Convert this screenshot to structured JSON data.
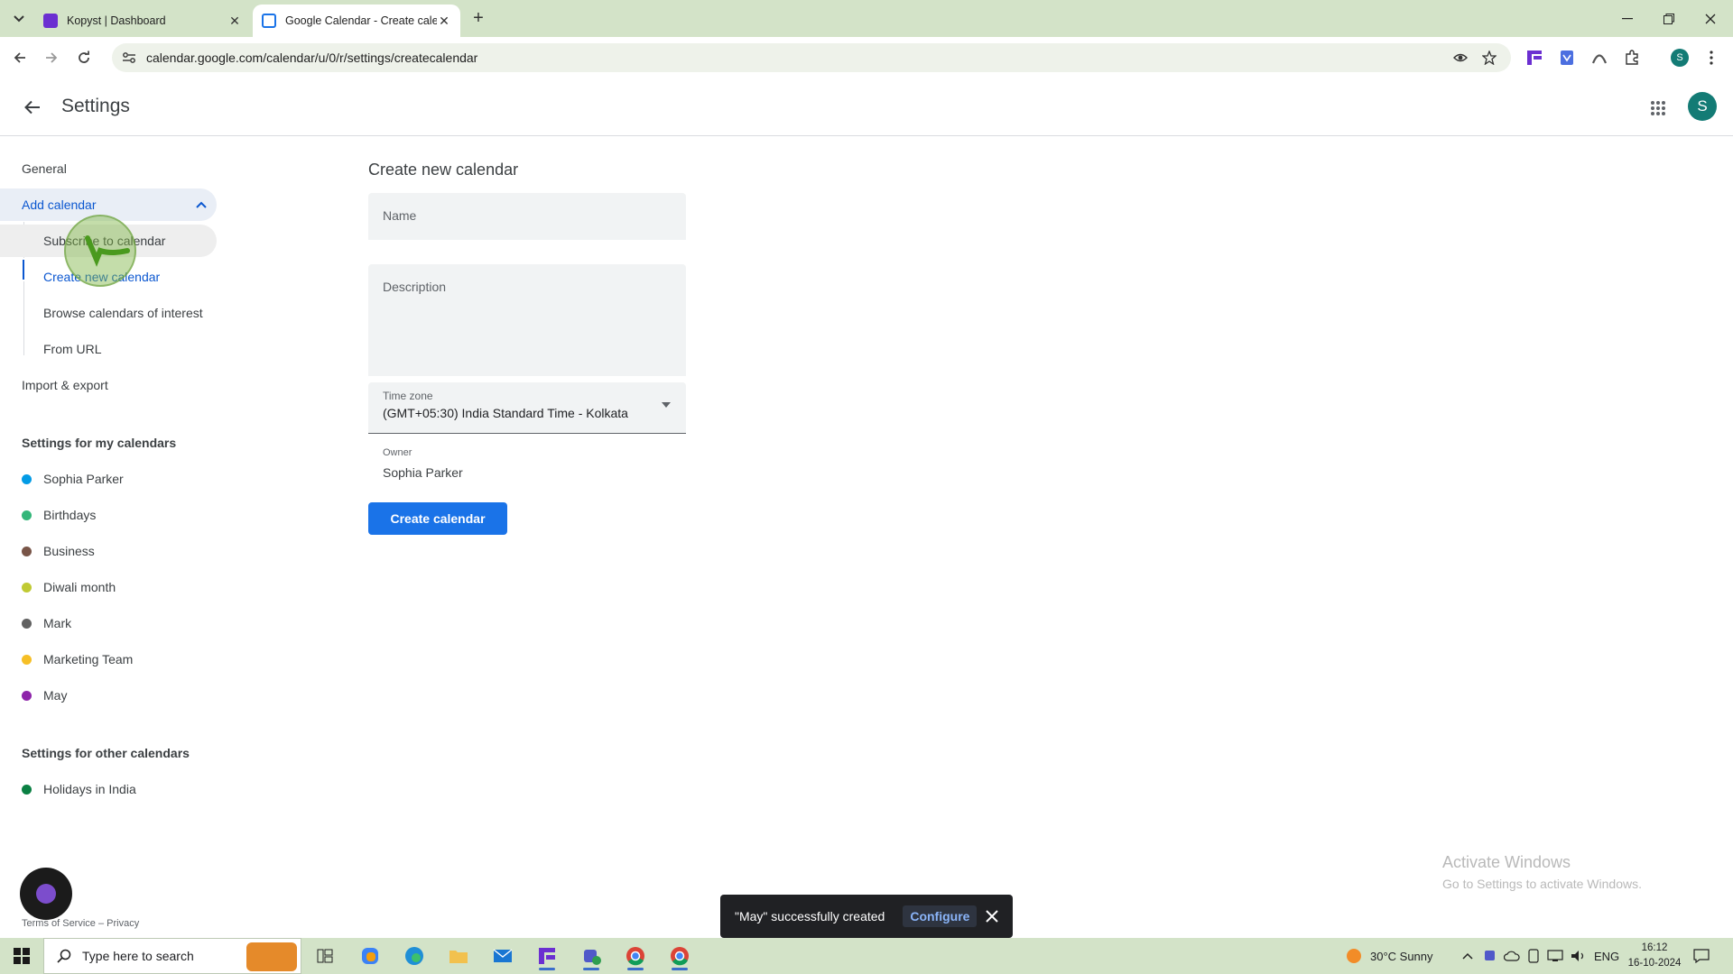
{
  "browser": {
    "tabs": [
      {
        "title": "Kopyst | Dashboard",
        "favicon_color": "#6b2fd1"
      },
      {
        "title": "Google Calendar - Create calen",
        "favicon_color": "#1a73e8"
      }
    ],
    "url": "calendar.google.com/calendar/u/0/r/settings/createcalendar",
    "profile_initial": "S"
  },
  "header": {
    "title": "Settings",
    "avatar_initial": "S"
  },
  "sidebar": {
    "general": "General",
    "add_calendar": "Add calendar",
    "sub_items": [
      "Subscribe to calendar",
      "Create new calendar",
      "Browse calendars of interest",
      "From URL"
    ],
    "import_export": "Import & export",
    "my_calendars_heading": "Settings for my calendars",
    "my_calendars": [
      {
        "name": "Sophia Parker",
        "color": "#039be5"
      },
      {
        "name": "Birthdays",
        "color": "#33b679"
      },
      {
        "name": "Business",
        "color": "#795548"
      },
      {
        "name": "Diwali month",
        "color": "#c0ca33"
      },
      {
        "name": "Mark",
        "color": "#616161"
      },
      {
        "name": "Marketing Team",
        "color": "#f6bf26"
      },
      {
        "name": "May",
        "color": "#8e24aa"
      }
    ],
    "other_calendars_heading": "Settings for other calendars",
    "other_calendars": [
      {
        "name": "Holidays in India",
        "color": "#0b8043"
      }
    ],
    "footer": "Terms of Service – Privacy"
  },
  "form": {
    "title": "Create new calendar",
    "name_placeholder": "Name",
    "description_placeholder": "Description",
    "timezone_label": "Time zone",
    "timezone_value": "(GMT+05:30) India Standard Time - Kolkata",
    "owner_label": "Owner",
    "owner_value": "Sophia Parker",
    "create_button": "Create calendar"
  },
  "snackbar": {
    "message": "\"May\" successfully created",
    "action": "Configure"
  },
  "watermark": {
    "title": "Activate Windows",
    "subtitle": "Go to Settings to activate Windows."
  },
  "taskbar": {
    "search_placeholder": "Type here to search",
    "weather": "30°C  Sunny",
    "language": "ENG",
    "time": "16:12",
    "date": "16-10-2024"
  }
}
